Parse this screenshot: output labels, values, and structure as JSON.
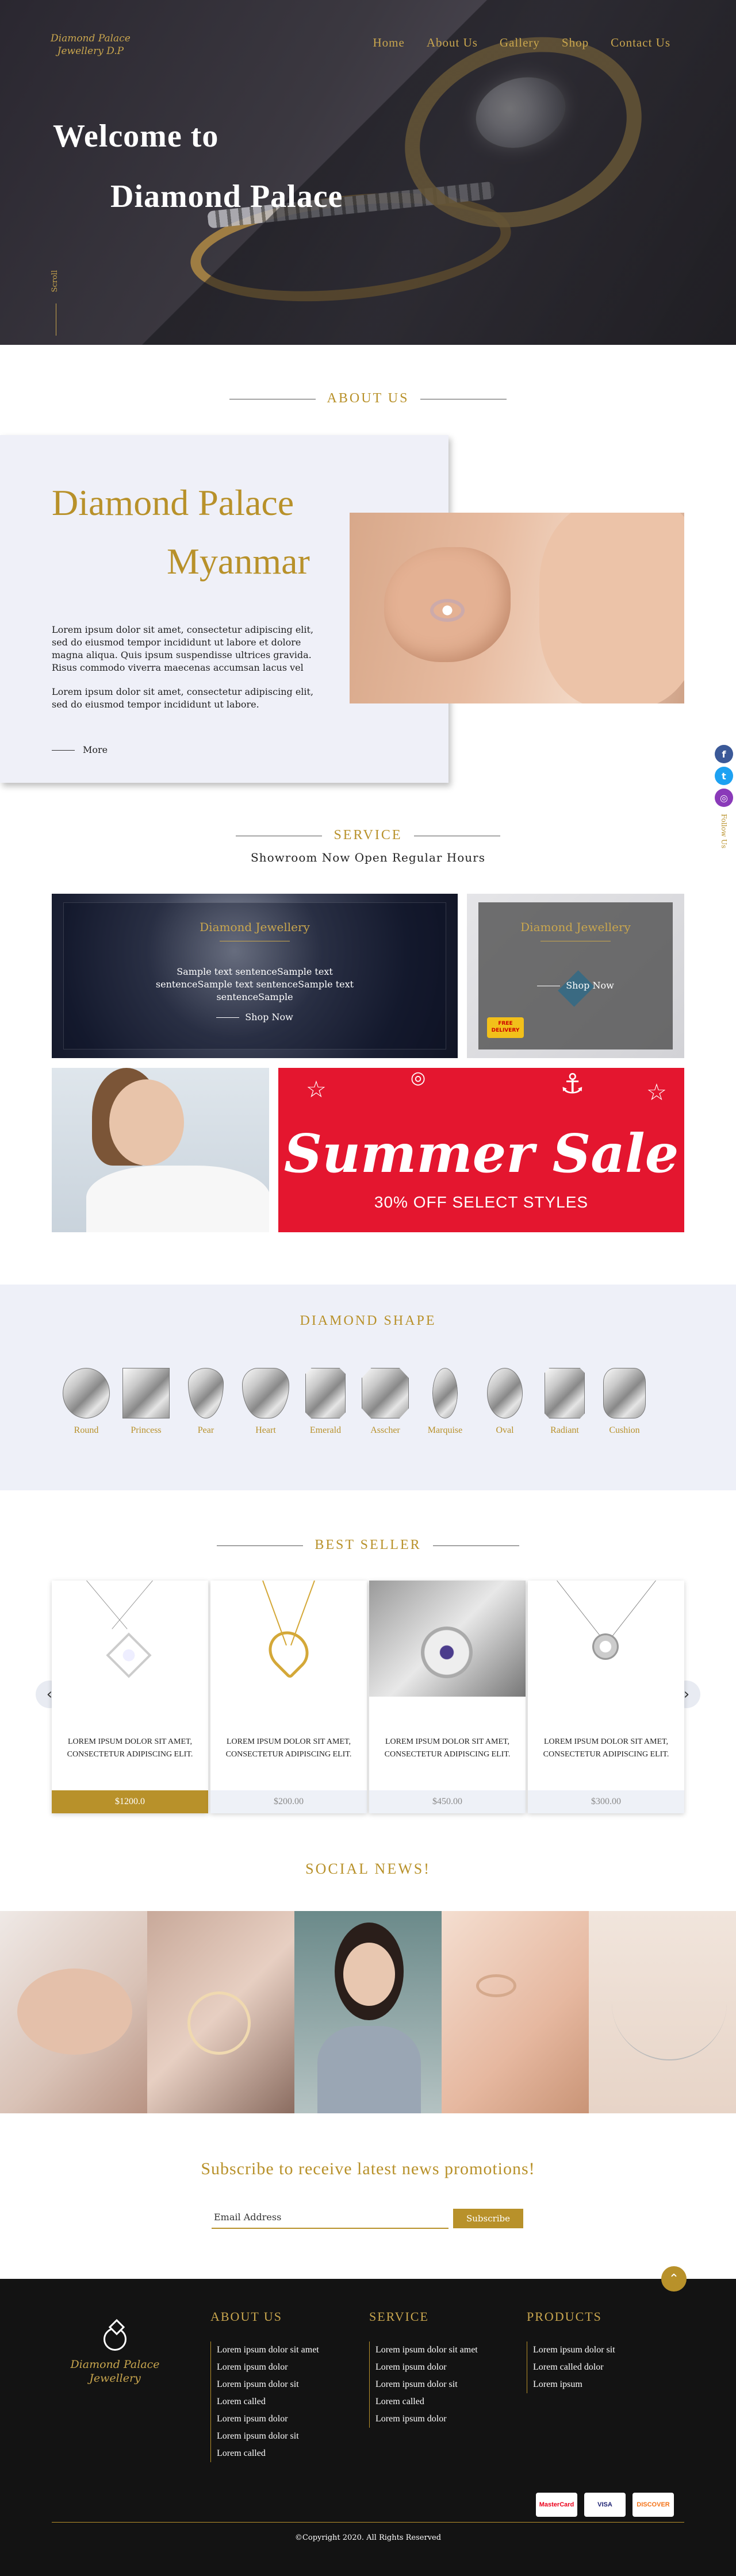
{
  "brand": {
    "logo_line1": "Diamond Palace",
    "logo_line2": "Jewellery D.P"
  },
  "nav": [
    {
      "label": "Home"
    },
    {
      "label": "About Us"
    },
    {
      "label": "Gallery"
    },
    {
      "label": "Shop"
    },
    {
      "label": "Contact Us"
    }
  ],
  "hero": {
    "title_line1": "Welcome to",
    "title_line2": "Diamond Palace",
    "scroll_label": "Scroll"
  },
  "about": {
    "section_title": "ABOUT US",
    "heading_line1": "Diamond Palace",
    "heading_line2": "Myanmar",
    "para1": "Lorem ipsum dolor sit amet, consectetur adipiscing elit, sed do eiusmod tempor incididunt ut labore et dolore magna aliqua. Quis ipsum suspendisse ultrices gravida. Risus commodo viverra maecenas accumsan lacus vel",
    "para2": "Lorem ipsum dolor sit amet, consectetur adipiscing elit, sed do eiusmod tempor incididunt ut labore.",
    "more_label": "More"
  },
  "side_social": {
    "facebook": "f",
    "twitter": "t",
    "instagram": "◎",
    "follow_label": "Follow Us"
  },
  "service": {
    "section_title": "SERVICE",
    "subtitle": "Showroom Now Open Regular Hours",
    "card1": {
      "title": "Diamond Jewellery",
      "text": "Sample text sentenceSample text sentenceSample text sentenceSample text sentenceSample",
      "shop": "Shop Now"
    },
    "card2": {
      "title": "Diamond Jewellery",
      "shop": "Shop Now",
      "truck": "FREE DELIVERY"
    },
    "sale": {
      "title": "Summer Sale",
      "subtitle": "30% OFF SELECT STYLES"
    }
  },
  "shapes": {
    "section_title": "DIAMOND SHAPE",
    "items": [
      "Round",
      "Princess",
      "Pear",
      "Heart",
      "Emerald",
      "Asscher",
      "Marquise",
      "Oval",
      "Radiant",
      "Cushion"
    ]
  },
  "best_seller": {
    "section_title": "BEST SELLER",
    "products": [
      {
        "name": "LOREM IPSUM DOLOR SIT AMET, CONSECTETUR ADIPISCING ELIT.",
        "price": "$1200.0"
      },
      {
        "name": "LOREM IPSUM DOLOR SIT AMET, CONSECTETUR ADIPISCING ELIT.",
        "price": "$200.00"
      },
      {
        "name": "LOREM IPSUM DOLOR SIT AMET, CONSECTETUR ADIPISCING ELIT.",
        "price": "$450.00"
      },
      {
        "name": "LOREM IPSUM DOLOR SIT AMET, CONSECTETUR ADIPISCING ELIT.",
        "price": "$300.00"
      }
    ],
    "prev_arrow": "‹",
    "next_arrow": "›"
  },
  "social_news": {
    "section_title": "SOCIAL NEWS!"
  },
  "subscribe": {
    "title": "Subscribe to receive latest news promotions!",
    "placeholder": "Email Address",
    "button": "Subscribe"
  },
  "footer": {
    "logo_line1": "Diamond Palace",
    "logo_line2": "Jewellery",
    "to_top": "⌃",
    "about": {
      "title": "ABOUT US",
      "items": [
        "Lorem ipsum dolor sit amet",
        "Lorem ipsum dolor",
        "Lorem ipsum dolor sit",
        "Lorem called",
        "Lorem ipsum dolor",
        "Lorem ipsum dolor sit",
        "Lorem called"
      ]
    },
    "service": {
      "title": "SERVICE",
      "items": [
        "Lorem ipsum dolor sit amet",
        "Lorem ipsum dolor",
        "Lorem ipsum dolor sit",
        "Lorem called",
        "Lorem ipsum dolor"
      ]
    },
    "products": {
      "title": "PRODUCTS",
      "items": [
        "Lorem ipsum dolor sit",
        "Lorem called dolor",
        "Lorem ipsum"
      ]
    },
    "cards": [
      "MasterCard",
      "VISA",
      "DISCOVER"
    ],
    "copyright": "©Copyright 2020. All Rights Reserved"
  },
  "colors": {
    "gold": "#b8912a",
    "dark": "#131313",
    "pale": "#eef0f8",
    "sale_red": "#e4162f"
  }
}
